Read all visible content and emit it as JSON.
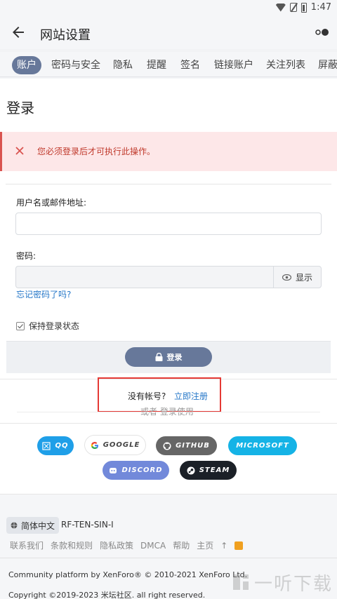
{
  "status_bar": {
    "time": "1:47"
  },
  "app_bar": {
    "title": "网站设置"
  },
  "tabs": [
    {
      "label": "账户"
    },
    {
      "label": "密码与安全"
    },
    {
      "label": "隐私"
    },
    {
      "label": "提醒"
    },
    {
      "label": "签名"
    },
    {
      "label": "链接账户"
    },
    {
      "label": "关注列表"
    },
    {
      "label": "屏蔽"
    }
  ],
  "page": {
    "title": "登录",
    "error": "您必须登录后才可执行此操作。",
    "username_label": "用户名或邮件地址:",
    "username_value": "",
    "password_label": "密码:",
    "password_value": "",
    "show_label": "显示",
    "forgot_label": "忘记密码了吗?",
    "remember_label": "保持登录状态",
    "login_label": "登录",
    "no_account": "没有帐号?",
    "register_label": "立即注册",
    "or_login": "或者 登录使用"
  },
  "social": [
    {
      "label": "QQ",
      "color": "#1f9fe8"
    },
    {
      "label": "GOOGLE",
      "color": "#ffffff"
    },
    {
      "label": "GITHUB",
      "color": "#666666"
    },
    {
      "label": "MICROSOFT",
      "color": "#15b3e6"
    },
    {
      "label": "DISCORD",
      "color": "#7289da"
    },
    {
      "label": "STEAM",
      "color": "#1b2027"
    }
  ],
  "footer": {
    "language": "简体中文",
    "style_id": "RF-TEN-SIN-I",
    "links": [
      "联系我们",
      "条款和规则",
      "隐私政策",
      "DMCA",
      "帮助",
      "主页",
      "↑"
    ],
    "copyright1": "Community platform by XenForo® © 2010-2021 XenForo Ltd.",
    "copyright2": "Copyright ©2019-2023 米坛社区. all right reserved."
  },
  "watermark": {
    "text": "一听下载"
  }
}
